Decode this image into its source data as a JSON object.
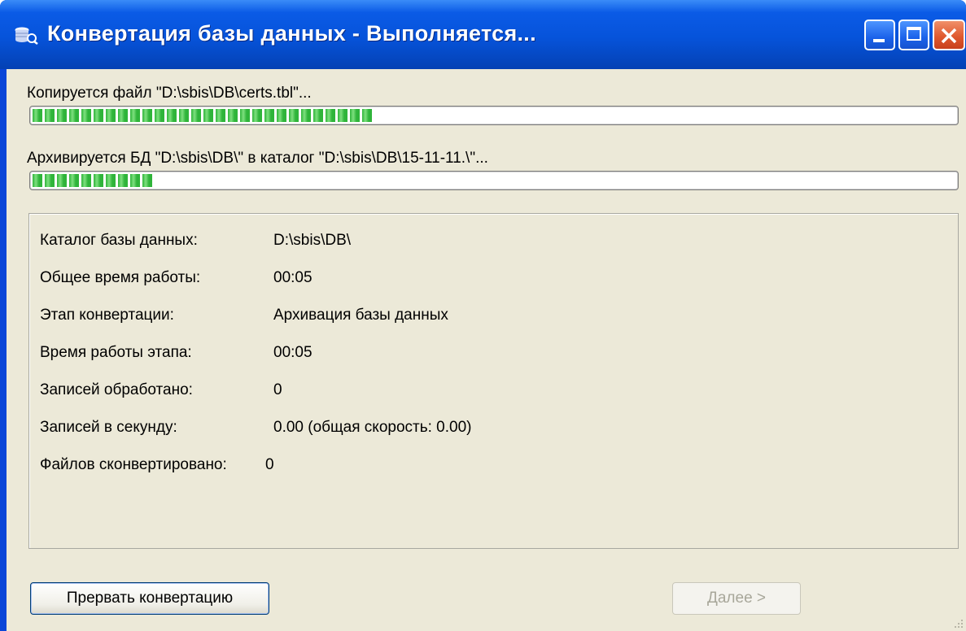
{
  "window": {
    "title": "Конвертация базы данных - Выполняется...",
    "icon": "database-icon",
    "controls": [
      "minimize-icon",
      "maximize-icon",
      "close-icon"
    ]
  },
  "progress": {
    "file": {
      "label": "Копируется файл \"D:\\sbis\\DB\\certs.tbl\"...",
      "fraction": 0.37
    },
    "archive": {
      "label": "Архивируется БД \"D:\\sbis\\DB\\\" в каталог \"D:\\sbis\\DB\\15-11-11.\\\"...",
      "fraction": 0.13
    }
  },
  "info": {
    "rows": [
      {
        "label": "Каталог базы данных:",
        "value": "D:\\sbis\\DB\\"
      },
      {
        "label": "Общее время работы:",
        "value": "00:05"
      },
      {
        "label": "Этап конвертации:",
        "value": "Архивация базы данных"
      },
      {
        "label": "Время работы этапа:",
        "value": "00:05"
      },
      {
        "label": "Записей обработано:",
        "value": "0"
      },
      {
        "label": "Записей в секунду:",
        "value": "0.00 (общая скорость: 0.00)"
      },
      {
        "label": "Файлов сконвертировано:",
        "value": "0"
      }
    ]
  },
  "buttons": {
    "abort": "Прервать конвертацию",
    "next": "Далее >"
  },
  "colors": {
    "titlebar": "#0653da",
    "client": "#ece9d8",
    "progress_fill": "#2fb43a",
    "close_button": "#e05a30"
  }
}
